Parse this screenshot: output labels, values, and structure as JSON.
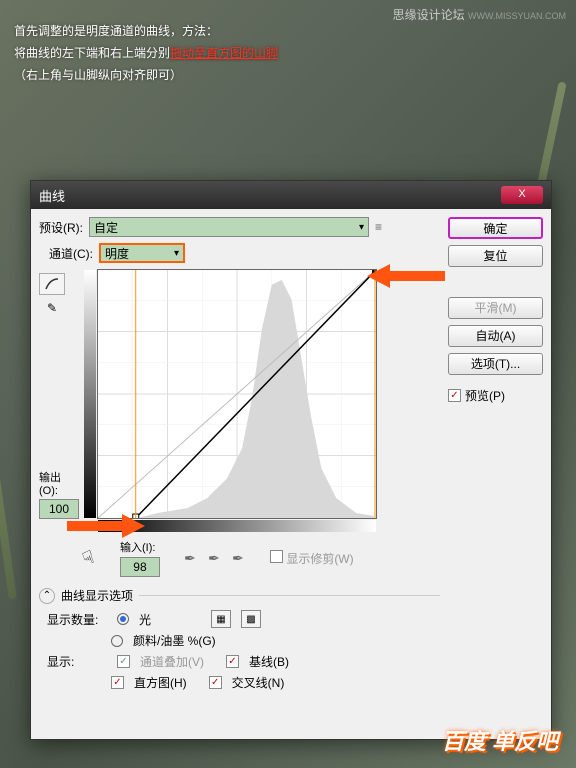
{
  "watermark_top": {
    "line1": "思缘设计论坛",
    "line2": "WWW.MISSYUAN.COM"
  },
  "watermark_bottom": "百度 单反吧",
  "annotation": {
    "line1": "首先调整的是明度通道的曲线，方法：",
    "line2a": "将曲线的左下端和右上端分别",
    "line2b": "拖动至直方图的山脚",
    "line3": "（右上角与山脚纵向对齐即可）"
  },
  "window": {
    "title": "曲线",
    "close": "X"
  },
  "preset": {
    "label": "预设(R):",
    "value": "自定",
    "menu_icon": "≡"
  },
  "channel": {
    "label": "通道(C):",
    "value": "明度"
  },
  "output": {
    "label": "输出(O):",
    "value": "100"
  },
  "input": {
    "label": "输入(I):",
    "value": "98"
  },
  "show_clip": {
    "checked": false,
    "label": "显示修剪(W)"
  },
  "section": "曲线显示选项",
  "display_amount": {
    "label": "显示数量:",
    "light": "光",
    "ink": "颜料/油墨 %(G)"
  },
  "display": {
    "label": "显示:",
    "overlay": "通道叠加(V)",
    "baseline": "基线(B)",
    "histogram": "直方图(H)",
    "cross": "交叉线(N)"
  },
  "buttons": {
    "ok": "确定",
    "reset": "复位",
    "smooth": "平滑(M)",
    "auto": "自动(A)",
    "options": "选项(T)..."
  },
  "preview": {
    "label": "预览(P)",
    "checked": true
  },
  "chart_data": {
    "type": "curve-histogram",
    "xlim": [
      0,
      255
    ],
    "ylim": [
      0,
      255
    ],
    "curve_points": [
      [
        35,
        0
      ],
      [
        255,
        255
      ]
    ],
    "histogram_peaks": [
      {
        "x": 170,
        "h": 0.95
      },
      {
        "x": 185,
        "h": 0.88
      },
      {
        "x": 160,
        "h": 0.72
      },
      {
        "x": 150,
        "h": 0.55
      },
      {
        "x": 140,
        "h": 0.4
      },
      {
        "x": 200,
        "h": 0.6
      },
      {
        "x": 210,
        "h": 0.3
      },
      {
        "x": 120,
        "h": 0.25
      },
      {
        "x": 100,
        "h": 0.15
      },
      {
        "x": 60,
        "h": 0.08
      },
      {
        "x": 230,
        "h": 0.12
      }
    ],
    "marker_left_x": 35,
    "marker_right_x": 255
  }
}
